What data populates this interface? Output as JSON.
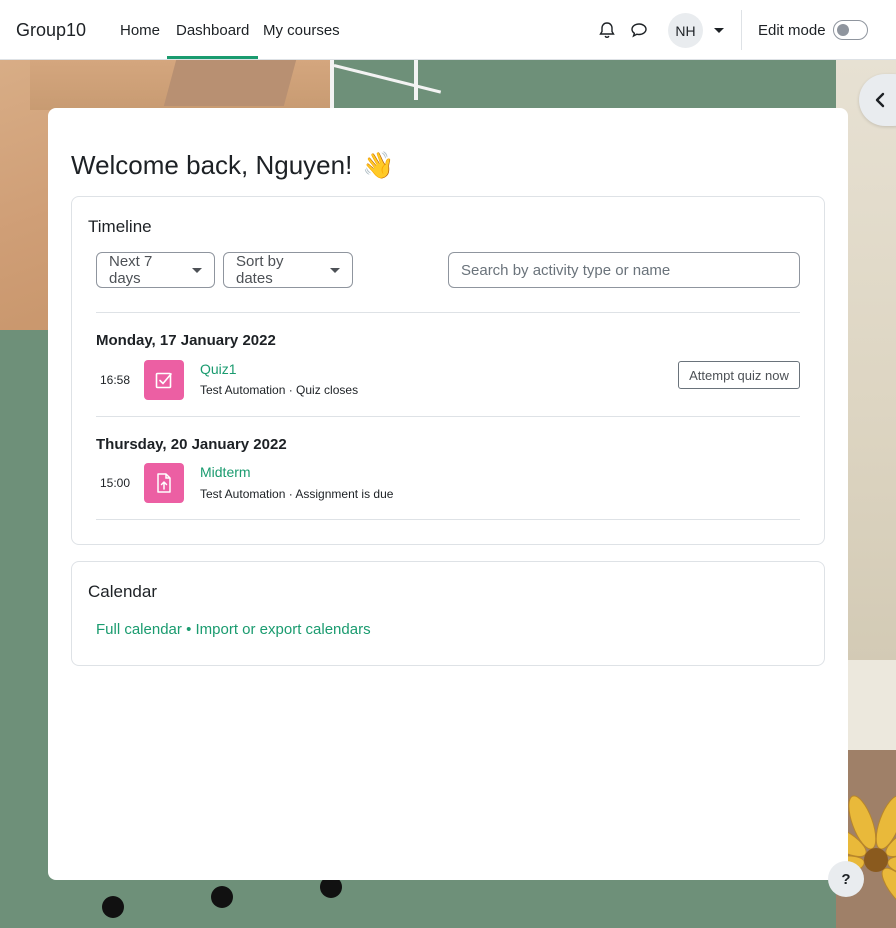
{
  "navbar": {
    "brand": "Group10",
    "links": [
      "Home",
      "Dashboard",
      "My courses"
    ],
    "active_link": "Dashboard",
    "avatar_initials": "NH",
    "edit_mode_label": "Edit mode",
    "edit_mode_on": false,
    "icons": [
      "bell-icon",
      "chat-icon",
      "chevron-down-icon"
    ]
  },
  "main": {
    "welcome": "Welcome back, Nguyen!",
    "welcome_emoji": "👋"
  },
  "timeline": {
    "title": "Timeline",
    "filter_days": "Next 7 days",
    "sort": "Sort by dates",
    "search_placeholder": "Search by activity type or name",
    "groups": [
      {
        "date": "Monday, 17 January 2022",
        "items": [
          {
            "time": "16:58",
            "name": "Quiz1",
            "meta": "Test Automation · Quiz closes",
            "action": "Attempt quiz now",
            "icon": "quiz-icon"
          }
        ]
      },
      {
        "date": "Thursday, 20 January 2022",
        "items": [
          {
            "time": "15:00",
            "name": "Midterm",
            "meta": "Test Automation · Assignment is due",
            "icon": "assignment-icon"
          }
        ]
      }
    ]
  },
  "calendar": {
    "title": "Calendar",
    "full_calendar": "Full calendar",
    "separator": "•",
    "import_export": "Import or export calendars"
  },
  "help_label": "?",
  "colors": {
    "accent": "#1a9b6f",
    "activity_icon": "#ec5fa3"
  }
}
